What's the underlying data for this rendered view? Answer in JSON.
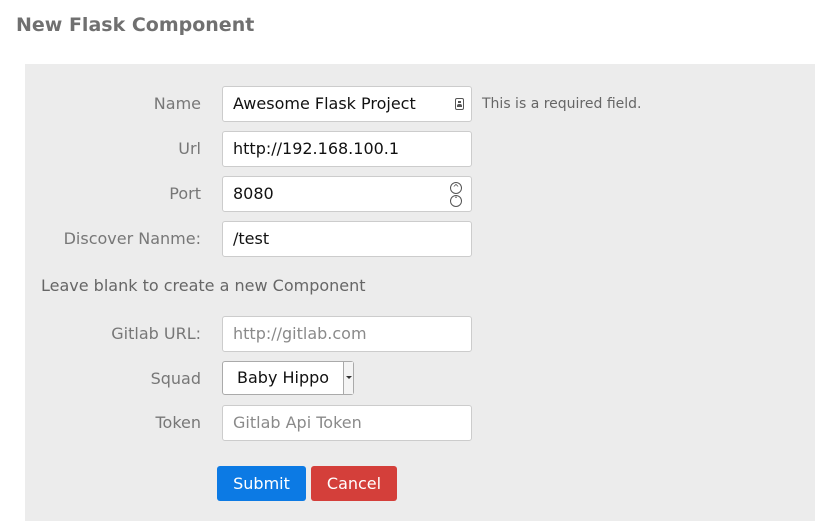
{
  "page": {
    "title": "New Flask Component"
  },
  "form": {
    "name": {
      "label": "Name",
      "value": "Awesome Flask Project",
      "help": "This is a required field."
    },
    "url": {
      "label": "Url",
      "value": "http://192.168.100.1"
    },
    "port": {
      "label": "Port",
      "value": "8080"
    },
    "discover": {
      "label": "Discover Nanme:",
      "value": "/test"
    },
    "note": "Leave blank to create a new Component",
    "gitlab_url": {
      "label": "Gitlab URL:",
      "placeholder": "http://gitlab.com"
    },
    "squad": {
      "label": "Squad",
      "selected": "Baby Hippo"
    },
    "token": {
      "label": "Token",
      "placeholder": "Gitlab Api Token"
    },
    "submit_label": "Submit",
    "cancel_label": "Cancel"
  },
  "colors": {
    "submit": "#0c7ae4",
    "cancel": "#d43f3a",
    "panel": "#ececec"
  },
  "icons": {
    "autofill": "contact-card-icon",
    "spinner_up": "chevron-up-icon",
    "spinner_down": "chevron-down-icon",
    "select": "caret-down-icon"
  }
}
